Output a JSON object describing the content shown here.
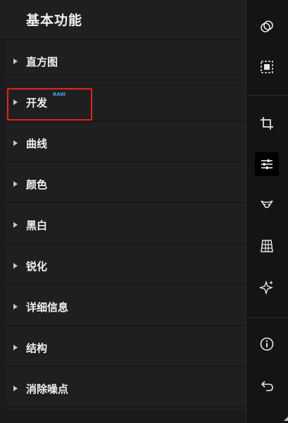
{
  "panel": {
    "title": "基本功能",
    "raw_badge": "RAW",
    "sections": [
      {
        "label": "直方图"
      },
      {
        "label": "开发"
      },
      {
        "label": "曲线"
      },
      {
        "label": "颜色"
      },
      {
        "label": "黑白"
      },
      {
        "label": "锐化"
      },
      {
        "label": "详细信息"
      },
      {
        "label": "结构"
      },
      {
        "label": "消除噪点"
      }
    ]
  },
  "toolbar": {
    "items": [
      {
        "icon": "overlap-circles-icon"
      },
      {
        "icon": "select-frame-icon"
      },
      {
        "icon": "crop-icon"
      },
      {
        "icon": "adjustments-sliders-icon",
        "active": true
      },
      {
        "icon": "face-retouch-icon"
      },
      {
        "icon": "perspective-grid-icon"
      },
      {
        "icon": "sparkle-effects-icon"
      },
      {
        "icon": "info-icon"
      },
      {
        "icon": "undo-icon"
      }
    ]
  },
  "colors": {
    "highlight_border": "#e3241e",
    "raw_badge": "#3aa0e6",
    "panel_bg": "#1f1f1f",
    "toolbar_bg": "#141414"
  }
}
